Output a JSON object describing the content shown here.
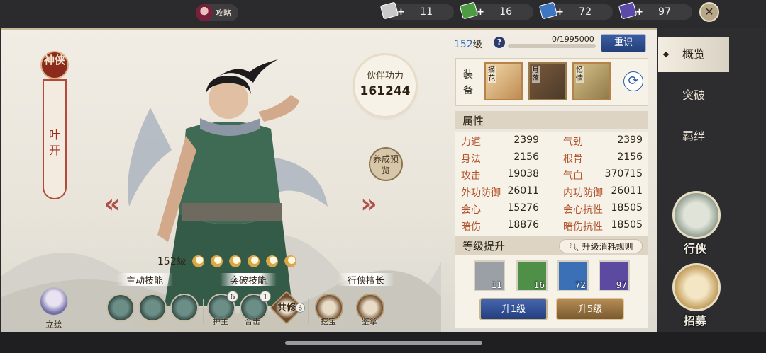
{
  "topbar": {
    "guide_label": "攻略",
    "resources": [
      {
        "icon": "white-book-ticket-icon",
        "count": "11",
        "color": "#c9c9c9"
      },
      {
        "icon": "green-book-ticket-icon",
        "count": "16",
        "color": "#4f9a45"
      },
      {
        "icon": "blue-book-ticket-icon",
        "count": "72",
        "color": "#3f76c2"
      },
      {
        "icon": "purple-book-ticket-icon",
        "count": "97",
        "color": "#5b4aa8"
      }
    ],
    "close_icon": "close-icon"
  },
  "character": {
    "rank_seal": "神侠",
    "name": "叶开",
    "level_label": "152级",
    "stars": 6
  },
  "power": {
    "label": "伙伴功力",
    "value": "161244"
  },
  "train_preview": "养成预览",
  "skills": {
    "active_title": "主动技能",
    "break_title": "突破技能",
    "specialty_title": "行侠擅长",
    "break_badges": [
      "6",
      "1"
    ],
    "co_cultivate_label": "共修",
    "co_cultivate_badge": "6",
    "captions": [
      "护主",
      "合击",
      "挖宝",
      "鉴拿"
    ],
    "portrait_label": "立绘"
  },
  "info": {
    "level": "152",
    "level_suffix": "级",
    "xp_text": "0/1995000",
    "xp_fraction": 0.0,
    "reset_label": "重识",
    "equip_label": "装备",
    "equipment": [
      {
        "tag": "摘花"
      },
      {
        "tag": "月落"
      },
      {
        "tag": "忆情"
      }
    ],
    "attr_title": "属性",
    "attrs": [
      {
        "k": "力道",
        "v": "2399"
      },
      {
        "k": "气劲",
        "v": "2399"
      },
      {
        "k": "身法",
        "v": "2156"
      },
      {
        "k": "根骨",
        "v": "2156"
      },
      {
        "k": "攻击",
        "v": "19038"
      },
      {
        "k": "气血",
        "v": "370715"
      },
      {
        "k": "外功防御",
        "v": "26011"
      },
      {
        "k": "内功防御",
        "v": "26011"
      },
      {
        "k": "会心",
        "v": "15276"
      },
      {
        "k": "会心抗性",
        "v": "18505"
      },
      {
        "k": "暗伤",
        "v": "18876"
      },
      {
        "k": "暗伤抗性",
        "v": "18505"
      }
    ],
    "upgrade_title": "等级提升",
    "rule_label": "升级消耗规则",
    "books": [
      {
        "count": "11",
        "color": "#9aa0a6"
      },
      {
        "count": "16",
        "color": "#4f8f48"
      },
      {
        "count": "72",
        "color": "#3b6fb6"
      },
      {
        "count": "97",
        "color": "#5b4aa0"
      }
    ],
    "up1_label": "升1级",
    "up5_label": "升5级"
  },
  "tabs": [
    {
      "label": "概览",
      "active": true
    },
    {
      "label": "突破",
      "active": false
    },
    {
      "label": "羁绊",
      "active": false
    }
  ],
  "side": {
    "roam_label": "行侠",
    "recruit_label": "招募"
  }
}
